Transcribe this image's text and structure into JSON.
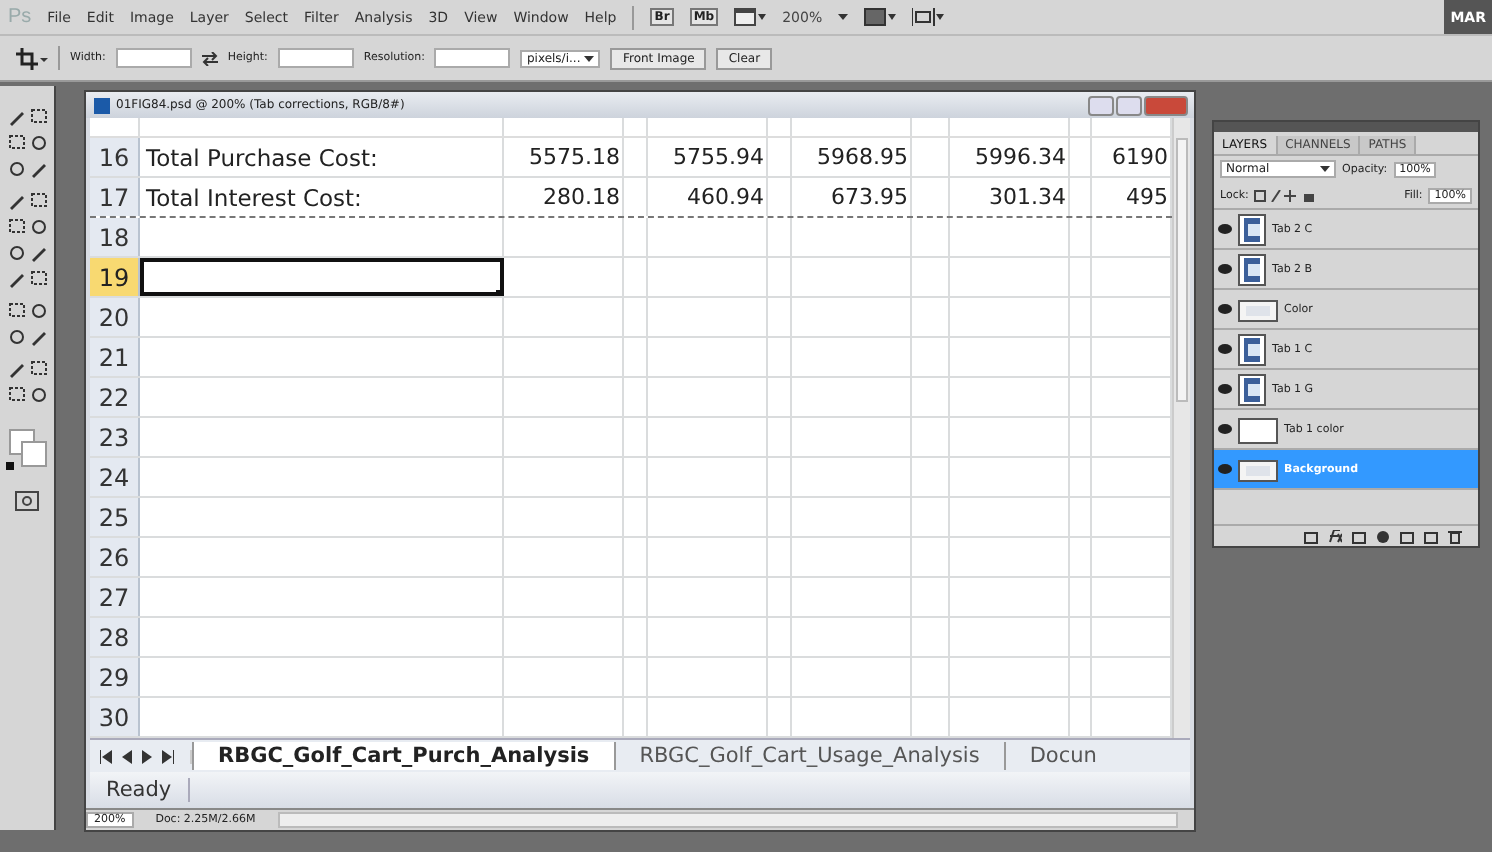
{
  "menu_bar": {
    "app_icon": "Ps",
    "items": [
      "File",
      "Edit",
      "Image",
      "Layer",
      "Select",
      "Filter",
      "Analysis",
      "3D",
      "View",
      "Window",
      "Help"
    ],
    "buttons": [
      "Br",
      "Mb"
    ],
    "zoom": "200%",
    "workspace": "MAR"
  },
  "options_bar": {
    "width_label": "Width:",
    "height_label": "Height:",
    "resolution_label": "Resolution:",
    "units": "pixels/i...",
    "buttons": [
      "Front Image",
      "Clear"
    ]
  },
  "document": {
    "title": "01FIG84.psd @ 200% (Tab corrections, RGB/8#)",
    "spreadsheet": {
      "rows": [
        {
          "number": "16",
          "label": "Total Purchase Cost:",
          "values": [
            "5575.18",
            "5755.94",
            "5968.95",
            "5996.34",
            "6190"
          ],
          "selected": false
        },
        {
          "number": "17",
          "label": "Total Interest Cost:",
          "values": [
            "280.18",
            "460.94",
            "673.95",
            "301.34",
            "495"
          ],
          "selected": false,
          "page_break": true
        },
        {
          "number": "18",
          "selected": false
        },
        {
          "number": "19",
          "selected": true
        },
        {
          "number": "20",
          "selected": false
        },
        {
          "number": "21",
          "selected": false
        },
        {
          "number": "22",
          "selected": false
        },
        {
          "number": "23",
          "selected": false
        },
        {
          "number": "24",
          "selected": false
        },
        {
          "number": "25",
          "selected": false
        },
        {
          "number": "26",
          "selected": false
        },
        {
          "number": "27",
          "selected": false
        },
        {
          "number": "28",
          "selected": false
        },
        {
          "number": "29",
          "selected": false
        },
        {
          "number": "30",
          "selected": false
        }
      ],
      "sheet_tabs": [
        {
          "label": "RBGC_Golf_Cart_Purch_Analysis",
          "selected": true
        },
        {
          "label": "RBGC_Golf_Cart_Usage_Analysis",
          "selected": false
        },
        {
          "label": "Docun",
          "selected": false
        }
      ],
      "status": "Ready"
    },
    "status_bar": {
      "zoom": "200%",
      "doc_size": "Doc: 2.25M/2.66M"
    }
  },
  "layers_panel": {
    "tabs": [
      {
        "label": "LAYERS",
        "selected": true
      },
      {
        "label": "CHANNELS",
        "selected": false
      },
      {
        "label": "PATHS",
        "selected": false
      }
    ],
    "blend_mode": "Normal",
    "opacity_label": "Opacity:",
    "opacity": "100%",
    "lock_label": "Lock:",
    "fill_label": "Fill:",
    "fill": "100%",
    "layers": [
      {
        "name": "Tab 2 C",
        "kind": "glyph",
        "selected": false
      },
      {
        "name": "Tab 2 B",
        "kind": "glyph",
        "selected": false
      },
      {
        "name": "Color",
        "kind": "swatch",
        "selected": false
      },
      {
        "name": "Tab 1 C",
        "kind": "glyph",
        "selected": false
      },
      {
        "name": "Tab 1 G",
        "kind": "glyph",
        "selected": false
      },
      {
        "name": "Tab 1 color",
        "kind": "plain",
        "selected": false
      },
      {
        "name": "Background",
        "kind": "swatch",
        "selected": true
      }
    ]
  }
}
